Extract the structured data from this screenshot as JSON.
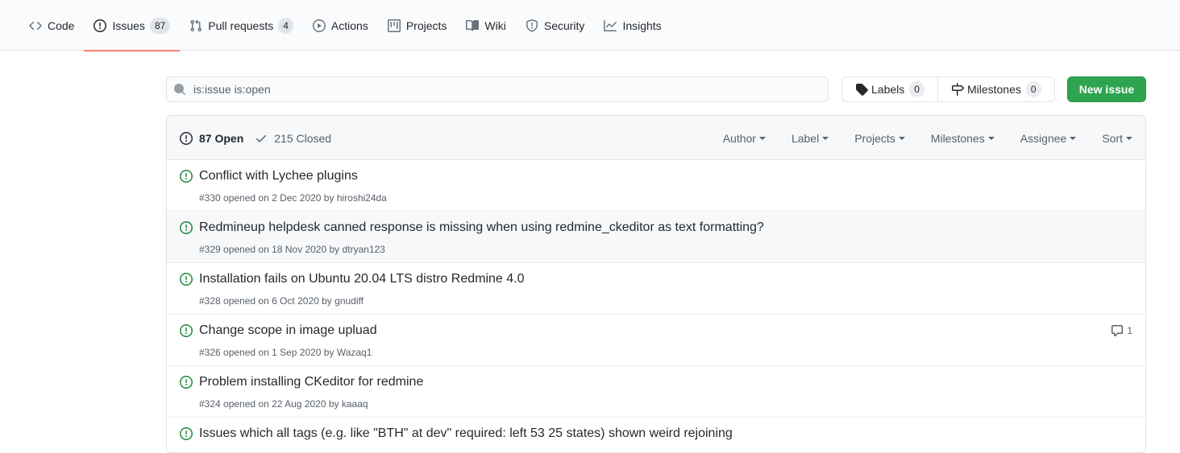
{
  "nav": {
    "tabs": [
      {
        "label": "Code",
        "counter": null,
        "icon": "code-icon"
      },
      {
        "label": "Issues",
        "counter": "87",
        "icon": "issue-opened-icon"
      },
      {
        "label": "Pull requests",
        "counter": "4",
        "icon": "git-pull-request-icon"
      },
      {
        "label": "Actions",
        "counter": null,
        "icon": "play-icon"
      },
      {
        "label": "Projects",
        "counter": null,
        "icon": "project-icon"
      },
      {
        "label": "Wiki",
        "counter": null,
        "icon": "book-icon"
      },
      {
        "label": "Security",
        "counter": null,
        "icon": "shield-icon"
      },
      {
        "label": "Insights",
        "counter": null,
        "icon": "graph-icon"
      }
    ],
    "selected_tab": "Issues",
    "accent": "#f9826c"
  },
  "search": {
    "value": "is:issue is:open"
  },
  "labels_button": {
    "label": "Labels",
    "count": "0"
  },
  "milestones_button": {
    "label": "Milestones",
    "count": "0"
  },
  "new_issue_button": {
    "label": "New issue",
    "color": "#2ea44f"
  },
  "states": {
    "open_label": "87 Open",
    "closed_label": "215 Closed"
  },
  "filters": [
    "Author",
    "Label",
    "Projects",
    "Milestones",
    "Assignee",
    "Sort"
  ],
  "issues": [
    {
      "title": "Conflict with Lychee plugins",
      "meta": "#330 opened on 2 Dec 2020 by ",
      "author": "hiroshi24da",
      "comments": null
    },
    {
      "title": "Redmineup helpdesk canned response is missing when using redmine_ckeditor as text formatting?",
      "meta": "#329 opened on 18 Nov 2020 by ",
      "author": "dtryan123",
      "comments": null
    },
    {
      "title": "Installation fails on Ubuntu 20.04 LTS distro Redmine 4.0",
      "meta": "#328 opened on 6 Oct 2020 by ",
      "author": "gnudiff",
      "comments": null
    },
    {
      "title": "Change scope in image upluad",
      "meta": "#326 opened on 1 Sep 2020 by ",
      "author": "Wazaq1",
      "comments": "1"
    },
    {
      "title": "Problem installing CKeditor for redmine",
      "meta": "#324 opened on 22 Aug 2020 by ",
      "author": "kaaaq",
      "comments": null
    },
    {
      "title": "Issues which all tags (e.g. like \"BTH\" at dev\" required: left 53 25 states) shown weird rejoining",
      "meta": "",
      "author": "",
      "comments": null
    }
  ],
  "colors": {
    "open_icon": "#22863a"
  }
}
